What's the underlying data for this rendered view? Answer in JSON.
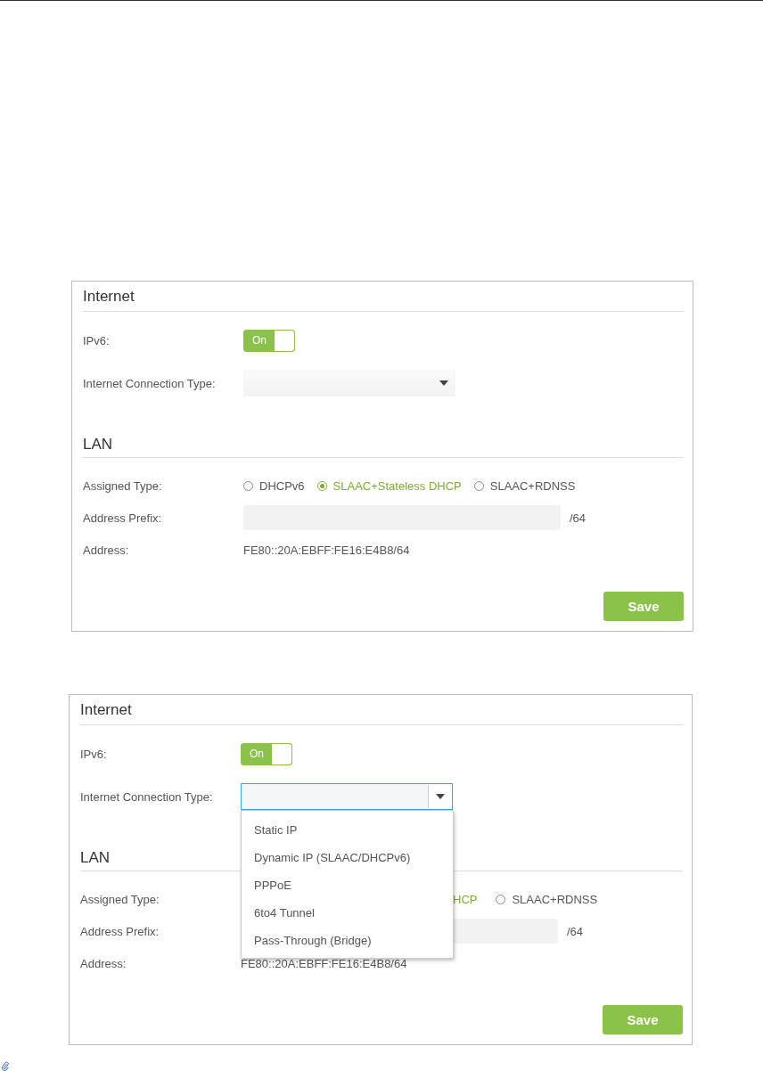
{
  "panels": [
    {
      "internet": {
        "heading": "Internet",
        "ipv6": {
          "label": "IPv6:",
          "toggle_text": "On",
          "on": true
        },
        "connection_type": {
          "label": "Internet Connection Type:",
          "expanded": false
        }
      },
      "lan": {
        "heading": "LAN",
        "assigned_type": {
          "label": "Assigned Type:",
          "options": [
            {
              "kind": "radio",
              "label": "DHCPv6",
              "selected": false
            },
            {
              "kind": "radio",
              "label": "SLAAC+Stateless DHCP",
              "selected": true
            },
            {
              "kind": "radio",
              "label": "SLAAC+RDNSS",
              "selected": false
            }
          ]
        },
        "address_prefix": {
          "label": "Address Prefix:",
          "suffix": "/64"
        },
        "address": {
          "label": "Address:",
          "value": "FE80::20A:EBFF:FE16:E4B8/64"
        }
      },
      "save": "Save"
    },
    {
      "internet": {
        "heading": "Internet",
        "ipv6": {
          "label": "IPv6:",
          "toggle_text": "On",
          "on": true
        },
        "connection_type": {
          "label": "Internet Connection Type:",
          "expanded": true,
          "options": [
            "Static IP",
            "Dynamic IP (SLAAC/DHCPv6)",
            "PPPoE",
            "6to4 Tunnel",
            "Pass-Through (Bridge)"
          ]
        }
      },
      "lan": {
        "heading": "LAN",
        "assigned_type": {
          "label": "Assigned Type:",
          "options": [
            {
              "kind": "partial",
              "label": "HCP",
              "selected": true
            },
            {
              "kind": "radio",
              "label": "SLAAC+RDNSS",
              "selected": false
            }
          ]
        },
        "address_prefix": {
          "label": "Address Prefix:",
          "suffix": "/64"
        },
        "address": {
          "label": "Address:",
          "value": "FE80::20A:EBFF:FE16:E4B8/64"
        }
      },
      "save": "Save"
    }
  ]
}
